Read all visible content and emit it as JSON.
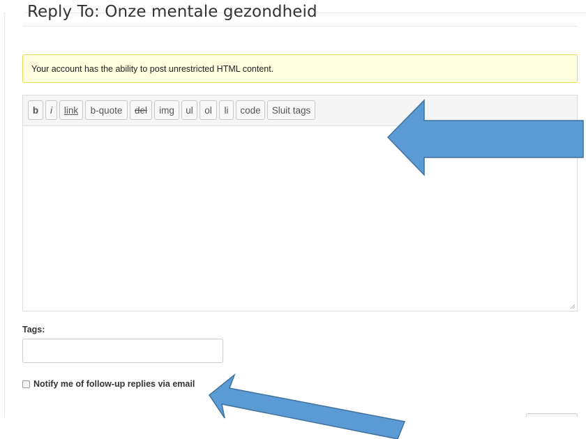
{
  "form": {
    "legend": "Reply To: Onze mentale gezondheid",
    "notice": "Your account has the ability to post unrestricted HTML content."
  },
  "toolbar": {
    "buttons": [
      "b",
      "i",
      "link",
      "b-quote",
      "del",
      "img",
      "ul",
      "ol",
      "li",
      "code",
      "Sluit tags"
    ]
  },
  "tags": {
    "label": "Tags:",
    "value": ""
  },
  "notify": {
    "label": "Notify me of follow-up replies via email",
    "checked": false
  },
  "colors": {
    "arrow_fill": "#5b9bd5",
    "arrow_stroke": "#41719c",
    "notice_bg": "#ffffe0"
  }
}
